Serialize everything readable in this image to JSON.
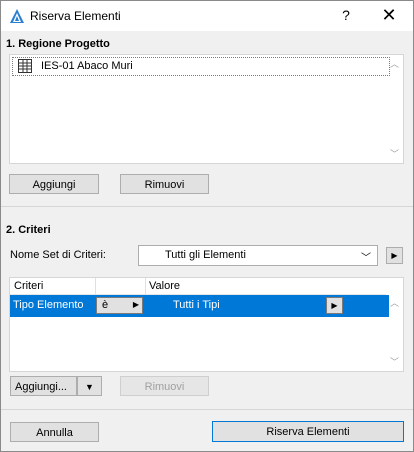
{
  "window": {
    "title": "Riserva Elementi",
    "help_label": "?",
    "close_label": "✕"
  },
  "section1": {
    "title": "1. Regione Progetto",
    "items": [
      {
        "label": "IES-01 Abaco Muri",
        "icon": "table-icon"
      }
    ],
    "add_label": "Aggiungi",
    "remove_label": "Rimuovi"
  },
  "section2": {
    "title": "2. Criteri",
    "set_label": "Nome Set di Criteri:",
    "set_value": "Tutti gli Elementi",
    "columns": [
      "Criteri",
      "Valore"
    ],
    "rows": [
      {
        "criterion": "Tipo Elemento",
        "operator": "è",
        "value": "Tutti i Tipi"
      }
    ],
    "add_label": "Aggiungi...",
    "remove_label": "Rimuovi"
  },
  "footer": {
    "cancel_label": "Annulla",
    "ok_label": "Riserva Elementi"
  },
  "colors": {
    "selection": "#0078d7",
    "background": "#f0f0f0"
  }
}
